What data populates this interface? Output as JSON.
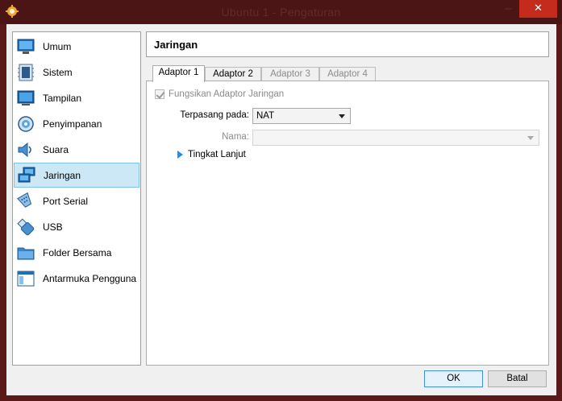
{
  "window": {
    "title": "Ubuntu 1 - Pengaturan",
    "close_glyph": "✕"
  },
  "sidebar": {
    "items": [
      {
        "label": "Umum",
        "icon": "monitor-icon"
      },
      {
        "label": "Sistem",
        "icon": "chip-icon"
      },
      {
        "label": "Tampilan",
        "icon": "display-icon"
      },
      {
        "label": "Penyimpanan",
        "icon": "disk-icon"
      },
      {
        "label": "Suara",
        "icon": "speaker-icon"
      },
      {
        "label": "Jaringan",
        "icon": "network-icon",
        "selected": true
      },
      {
        "label": "Port Serial",
        "icon": "serial-port-icon"
      },
      {
        "label": "USB",
        "icon": "usb-icon"
      },
      {
        "label": "Folder Bersama",
        "icon": "folder-icon"
      },
      {
        "label": "Antarmuka Pengguna",
        "icon": "window-icon"
      }
    ]
  },
  "page": {
    "title": "Jaringan"
  },
  "tabs": [
    {
      "label": "Adaptor 1",
      "state": "active"
    },
    {
      "label": "Adaptor 2",
      "state": "enabled"
    },
    {
      "label": "Adaptor 3",
      "state": "disabled"
    },
    {
      "label": "Adaptor 4",
      "state": "disabled"
    }
  ],
  "adapter": {
    "enable_label": "Fungsikan Adaptor Jaringan",
    "enable_checked": true,
    "attached_label": "Terpasang pada:",
    "attached_value": "NAT",
    "name_label": "Nama:",
    "name_value": "",
    "advanced_label": "Tingkat Lanjut"
  },
  "buttons": {
    "ok": "OK",
    "cancel": "Batal"
  },
  "colors": {
    "titlebar": "#4b1515",
    "close_button": "#c42b1c",
    "selection": "#cce8f6",
    "accent": "#2a8be0"
  }
}
